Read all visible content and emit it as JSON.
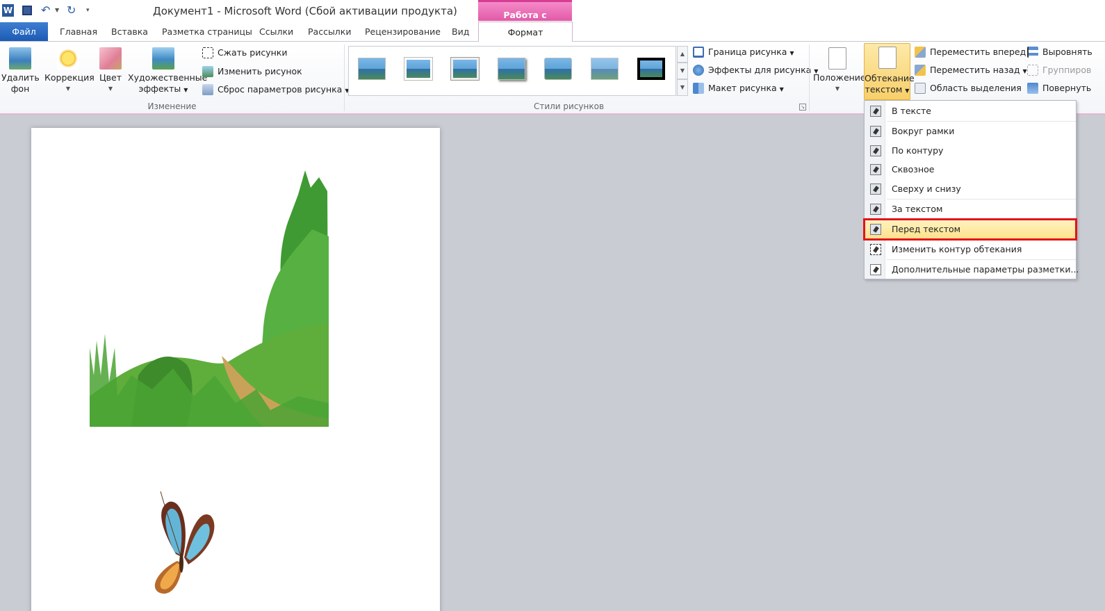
{
  "titlebar": {
    "app_icon": "word-icon",
    "qat": [
      "save-icon",
      "undo-icon",
      "redo-icon",
      "customize-icon"
    ],
    "title": "Документ1  -  Microsoft Word (Сбой активации продукта)",
    "tools_context": "Работа с рисунками"
  },
  "tabs": {
    "file": "Файл",
    "items": [
      "Главная",
      "Вставка",
      "Разметка страницы",
      "Ссылки",
      "Рассылки",
      "Рецензирование",
      "Вид"
    ],
    "active": "Формат"
  },
  "ribbon": {
    "adjust": {
      "remove_bg_line1": "Удалить",
      "remove_bg_line2": "фон",
      "correction": "Коррекция",
      "color": "Цвет",
      "artistic_line1": "Художественные",
      "artistic_line2": "эффекты",
      "compress": "Сжать рисунки",
      "change": "Изменить рисунок",
      "reset": "Сброс параметров рисунка",
      "label": "Изменение"
    },
    "styles": {
      "border": "Граница рисунка",
      "effects": "Эффекты для рисунка",
      "layout": "Макет рисунка",
      "label": "Стили рисунков"
    },
    "arrange": {
      "position": "Положение",
      "wrap_line1": "Обтекание",
      "wrap_line2": "текстом",
      "forward": "Переместить вперед",
      "backward": "Переместить назад",
      "selection": "Область выделения",
      "align": "Выровнять",
      "group": "Группиров",
      "rotate": "Повернуть"
    }
  },
  "wrap_menu": {
    "items": [
      "В тексте",
      "Вокруг рамки",
      "По контуру",
      "Сквозное",
      "Сверху и снизу",
      "За текстом",
      "Перед текстом",
      "Изменить контур обтекания",
      "Дополнительные параметры разметки..."
    ],
    "selected": "Перед текстом",
    "highlight_color": "#e2141b"
  },
  "colors": {
    "file_tab": "#2b6cc4",
    "context_tab": "#e25aa8",
    "workspace": "#c9ccd3"
  }
}
